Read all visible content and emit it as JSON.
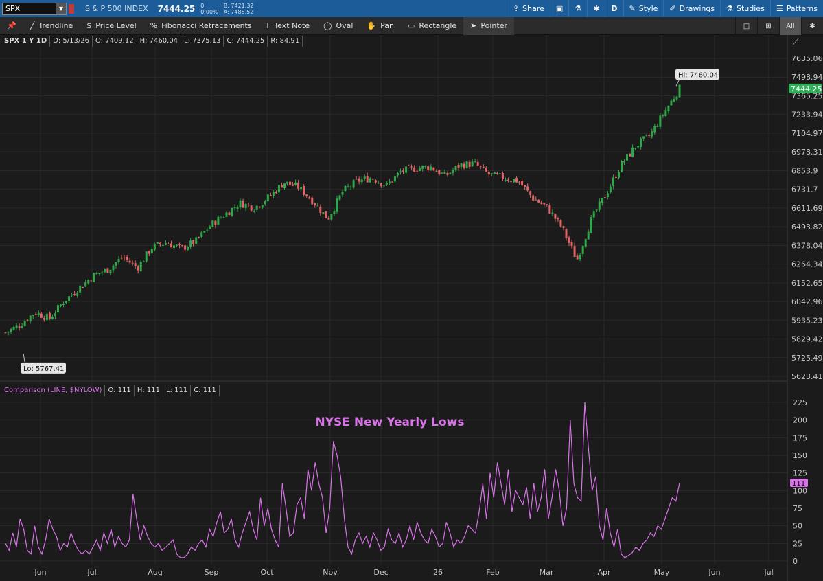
{
  "topbar": {
    "symbol": "SPX",
    "description": "S & P 500 INDEX",
    "price": "7444.25",
    "change": "0",
    "change_pct": "0.00%",
    "bid": "B: 7421.32",
    "ask": "A: 7486.52",
    "share": "Share",
    "timeframe": "D",
    "style": "Style",
    "drawings": "Drawings",
    "studies": "Studies",
    "patterns": "Patterns"
  },
  "toolbar": {
    "trendline": "Trendline",
    "price_level": "Price Level",
    "fibonacci": "Fibonacci Retracements",
    "text_note": "Text Note",
    "oval": "Oval",
    "pan": "Pan",
    "rectangle": "Rectangle",
    "pointer": "Pointer",
    "all": "All"
  },
  "infobar": {
    "label": "SPX 1 Y 1D",
    "date": "D: 5/13/26",
    "open": "O: 7409.12",
    "high": "H: 7460.04",
    "low": "L: 7375.13",
    "close": "C: 7444.25",
    "range": "R: 84.91"
  },
  "compare_bar": {
    "label": "Comparison (LINE, $NYLOW)",
    "open": "O: 111",
    "high": "H: 111",
    "low": "L: 111",
    "close": "C: 111"
  },
  "chart_data": [
    {
      "type": "candlestick",
      "symbol": "SPX",
      "y_ticks": [
        "7635.06",
        "7498.94",
        "7365.25",
        "7233.94",
        "7104.97",
        "6978.31",
        "6853.9",
        "6731.7",
        "6611.69",
        "6493.82",
        "6378.04",
        "6264.34",
        "6152.65",
        "6042.96",
        "5935.23",
        "5829.42",
        "5725.49",
        "5623.41"
      ],
      "last_price_label": "7444.25",
      "hi_label": "Hi: 7460.04",
      "lo_label": "Lo: 5767.41",
      "close_series": [
        {
          "month": "May",
          "close": 5900
        },
        {
          "month": "Jun",
          "close": 5950
        },
        {
          "month": "Jun",
          "close": 6030
        },
        {
          "month": "Jun",
          "close": 5990
        },
        {
          "month": "Jul",
          "close": 6100
        },
        {
          "month": "Jul",
          "close": 6180
        },
        {
          "month": "Jul",
          "close": 6260
        },
        {
          "month": "Jul",
          "close": 6300
        },
        {
          "month": "Aug",
          "close": 6380
        },
        {
          "month": "Aug",
          "close": 6310
        },
        {
          "month": "Aug",
          "close": 6440
        },
        {
          "month": "Aug",
          "close": 6470
        },
        {
          "month": "Sep",
          "close": 6430
        },
        {
          "month": "Sep",
          "close": 6480
        },
        {
          "month": "Sep",
          "close": 6580
        },
        {
          "month": "Sep",
          "close": 6650
        },
        {
          "month": "Oct",
          "close": 6720
        },
        {
          "month": "Oct",
          "close": 6690
        },
        {
          "month": "Oct",
          "close": 6760
        },
        {
          "month": "Oct",
          "close": 6850
        },
        {
          "month": "Nov",
          "close": 6820
        },
        {
          "month": "Nov",
          "close": 6730
        },
        {
          "month": "Nov",
          "close": 6620
        },
        {
          "month": "Nov",
          "close": 6790
        },
        {
          "month": "Dec",
          "close": 6860
        },
        {
          "month": "Dec",
          "close": 6880
        },
        {
          "month": "Dec",
          "close": 6830
        },
        {
          "month": "Dec",
          "close": 6920
        },
        {
          "month": "Jan",
          "close": 6940
        },
        {
          "month": "Jan",
          "close": 6950
        },
        {
          "month": "Jan",
          "close": 6890
        },
        {
          "month": "Jan",
          "close": 6960
        },
        {
          "month": "Feb",
          "close": 6970
        },
        {
          "month": "Feb",
          "close": 6900
        },
        {
          "month": "Feb",
          "close": 6880
        },
        {
          "month": "Feb",
          "close": 6860
        },
        {
          "month": "Mar",
          "close": 6750
        },
        {
          "month": "Mar",
          "close": 6690
        },
        {
          "month": "Mar",
          "close": 6560
        },
        {
          "month": "Mar",
          "close": 6360
        },
        {
          "month": "Apr",
          "close": 6620
        },
        {
          "month": "Apr",
          "close": 6780
        },
        {
          "month": "Apr",
          "close": 6960
        },
        {
          "month": "Apr",
          "close": 7080
        },
        {
          "month": "May",
          "close": 7150
        },
        {
          "month": "May",
          "close": 7300
        },
        {
          "month": "May",
          "close": 7444
        }
      ],
      "x_ticks": [
        "Jun",
        "Jul",
        "Aug",
        "Sep",
        "Oct",
        "Nov",
        "Dec",
        "26",
        "Feb",
        "Mar",
        "Apr",
        "May",
        "Jun",
        "Jul"
      ]
    },
    {
      "type": "line",
      "series_name": "$NYLOW",
      "title": "NYSE New Yearly Lows",
      "y_ticks": [
        "225",
        "200",
        "175",
        "150",
        "125",
        "100",
        "75",
        "50",
        "25",
        "0"
      ],
      "last_value_label": "111",
      "values": [
        25,
        15,
        40,
        20,
        60,
        45,
        15,
        10,
        50,
        20,
        10,
        30,
        60,
        45,
        35,
        15,
        25,
        20,
        40,
        25,
        15,
        10,
        15,
        10,
        20,
        30,
        15,
        40,
        25,
        45,
        20,
        35,
        25,
        20,
        30,
        95,
        60,
        30,
        50,
        35,
        25,
        20,
        25,
        15,
        20,
        25,
        30,
        10,
        5,
        5,
        10,
        20,
        15,
        25,
        30,
        20,
        45,
        35,
        55,
        70,
        40,
        45,
        60,
        30,
        20,
        40,
        55,
        70,
        45,
        30,
        90,
        50,
        75,
        45,
        30,
        20,
        110,
        75,
        35,
        40,
        80,
        90,
        60,
        130,
        100,
        140,
        110,
        90,
        40,
        75,
        170,
        150,
        120,
        60,
        20,
        10,
        30,
        40,
        25,
        35,
        20,
        40,
        30,
        15,
        20,
        45,
        30,
        25,
        40,
        20,
        30,
        50,
        30,
        55,
        40,
        30,
        25,
        45,
        35,
        20,
        25,
        55,
        40,
        20,
        30,
        25,
        35,
        50,
        45,
        40,
        70,
        110,
        60,
        125,
        90,
        140,
        110,
        80,
        130,
        70,
        100,
        90,
        80,
        105,
        60,
        110,
        70,
        90,
        130,
        60,
        90,
        130,
        100,
        50,
        75,
        200,
        110,
        90,
        85,
        225,
        160,
        100,
        120,
        50,
        30,
        75,
        40,
        20,
        45,
        10,
        5,
        8,
        12,
        20,
        15,
        25,
        30,
        40,
        35,
        50,
        45,
        60,
        75,
        90,
        85,
        111
      ],
      "x_ticks": [
        "Jun",
        "Jul",
        "Aug",
        "Sep",
        "Oct",
        "Nov",
        "Dec",
        "26",
        "Feb",
        "Mar",
        "Apr",
        "May",
        "Jun",
        "Jul"
      ]
    }
  ],
  "colors": {
    "up": "#2fa84a",
    "down": "#e06466",
    "line": "#d873e8",
    "price_badge": "#31b05a",
    "topbar": "#1c5c98"
  }
}
